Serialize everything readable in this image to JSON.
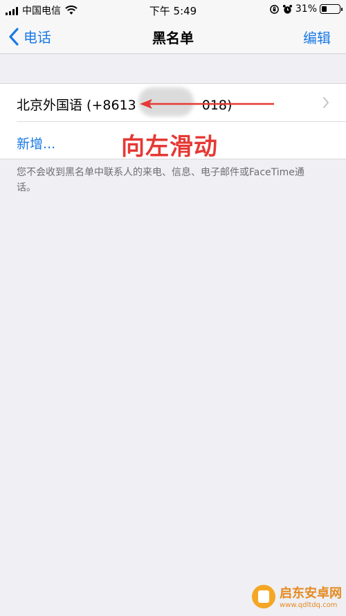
{
  "status_bar": {
    "carrier": "中国电信",
    "time": "下午 5:49",
    "battery_percent": "31%",
    "battery_level": 0.31,
    "icons": [
      "signal-icon",
      "wifi-icon",
      "rotation-lock-icon",
      "alarm-icon",
      "battery-icon"
    ]
  },
  "nav": {
    "back_label": "电话",
    "title": "黑名单",
    "edit_label": "编辑"
  },
  "list": {
    "contact": "北京外国语 (+8613",
    "contact_tail": "018)",
    "add_label": "新增..."
  },
  "annotation": {
    "text": "向左滑动",
    "color": "#e53935"
  },
  "footer_note": "您不会收到黑名单中联系人的来电、信息、电子邮件或FaceTime通话。",
  "watermark": {
    "name": "启东安卓网",
    "url": "www.qdltdq.com"
  },
  "colors": {
    "accent": "#1a7ae6",
    "background": "#efeff4"
  }
}
